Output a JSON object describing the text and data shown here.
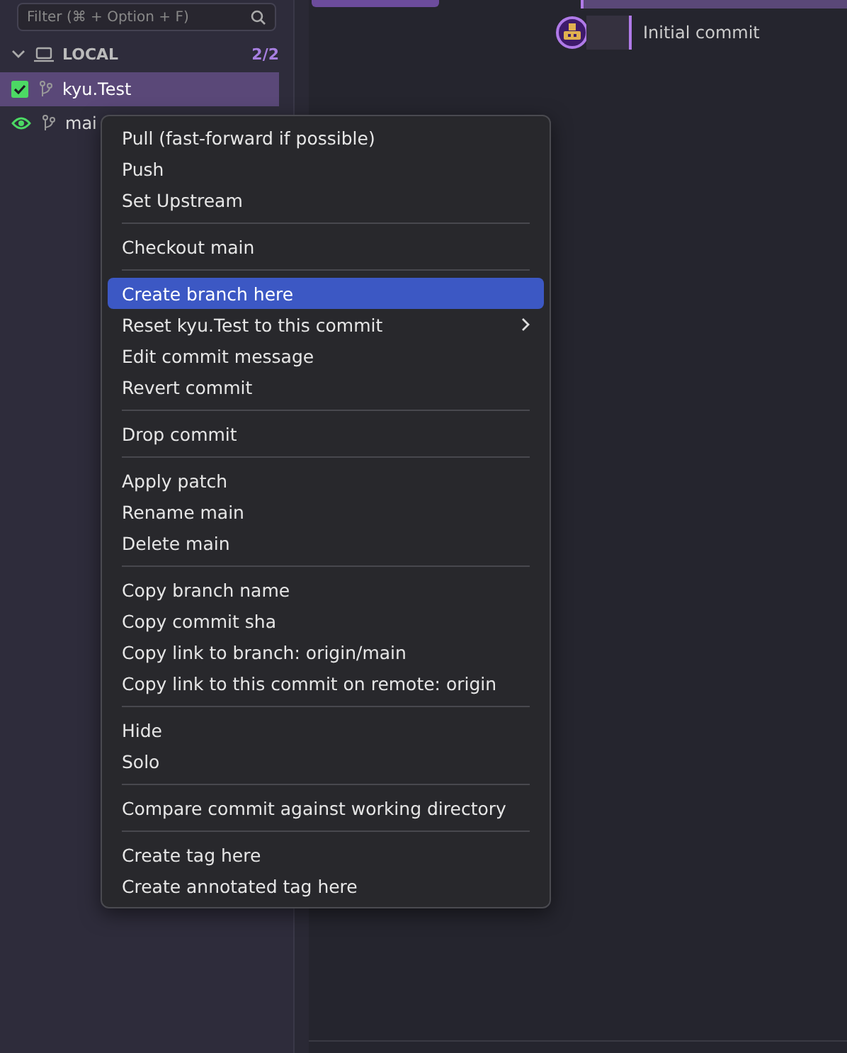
{
  "sidebar": {
    "filter": {
      "placeholder": "Filter (⌘ + Option + F)"
    },
    "section": {
      "title": "LOCAL",
      "count": "2/2",
      "expanded": true
    },
    "branches": [
      {
        "name": "kyu.Test",
        "kind": "head",
        "selected": true
      },
      {
        "name": "mai",
        "kind": "visible",
        "selected": false
      }
    ]
  },
  "graph": {
    "commits": [
      {
        "message": "Initial commit"
      }
    ]
  },
  "context_menu": {
    "groups": [
      [
        {
          "label": "Pull (fast-forward if possible)",
          "selected": false,
          "submenu": false
        },
        {
          "label": "Push",
          "selected": false,
          "submenu": false
        },
        {
          "label": "Set Upstream",
          "selected": false,
          "submenu": false
        }
      ],
      [
        {
          "label": "Checkout main",
          "selected": false,
          "submenu": false
        }
      ],
      [
        {
          "label": "Create branch here",
          "selected": true,
          "submenu": false
        },
        {
          "label": "Reset kyu.Test to this commit",
          "selected": false,
          "submenu": true
        },
        {
          "label": "Edit commit message",
          "selected": false,
          "submenu": false
        },
        {
          "label": "Revert commit",
          "selected": false,
          "submenu": false
        }
      ],
      [
        {
          "label": "Drop commit",
          "selected": false,
          "submenu": false
        }
      ],
      [
        {
          "label": "Apply patch",
          "selected": false,
          "submenu": false
        },
        {
          "label": "Rename main",
          "selected": false,
          "submenu": false
        },
        {
          "label": "Delete main",
          "selected": false,
          "submenu": false
        }
      ],
      [
        {
          "label": "Copy branch name",
          "selected": false,
          "submenu": false
        },
        {
          "label": "Copy commit sha",
          "selected": false,
          "submenu": false
        },
        {
          "label": "Copy link to branch: origin/main",
          "selected": false,
          "submenu": false
        },
        {
          "label": "Copy link to this commit on remote: origin",
          "selected": false,
          "submenu": false
        }
      ],
      [
        {
          "label": "Hide",
          "selected": false,
          "submenu": false
        },
        {
          "label": "Solo",
          "selected": false,
          "submenu": false
        }
      ],
      [
        {
          "label": "Compare commit against working directory",
          "selected": false,
          "submenu": false
        }
      ],
      [
        {
          "label": "Create tag here",
          "selected": false,
          "submenu": false
        },
        {
          "label": "Create annotated tag here",
          "selected": false,
          "submenu": false
        }
      ]
    ]
  }
}
